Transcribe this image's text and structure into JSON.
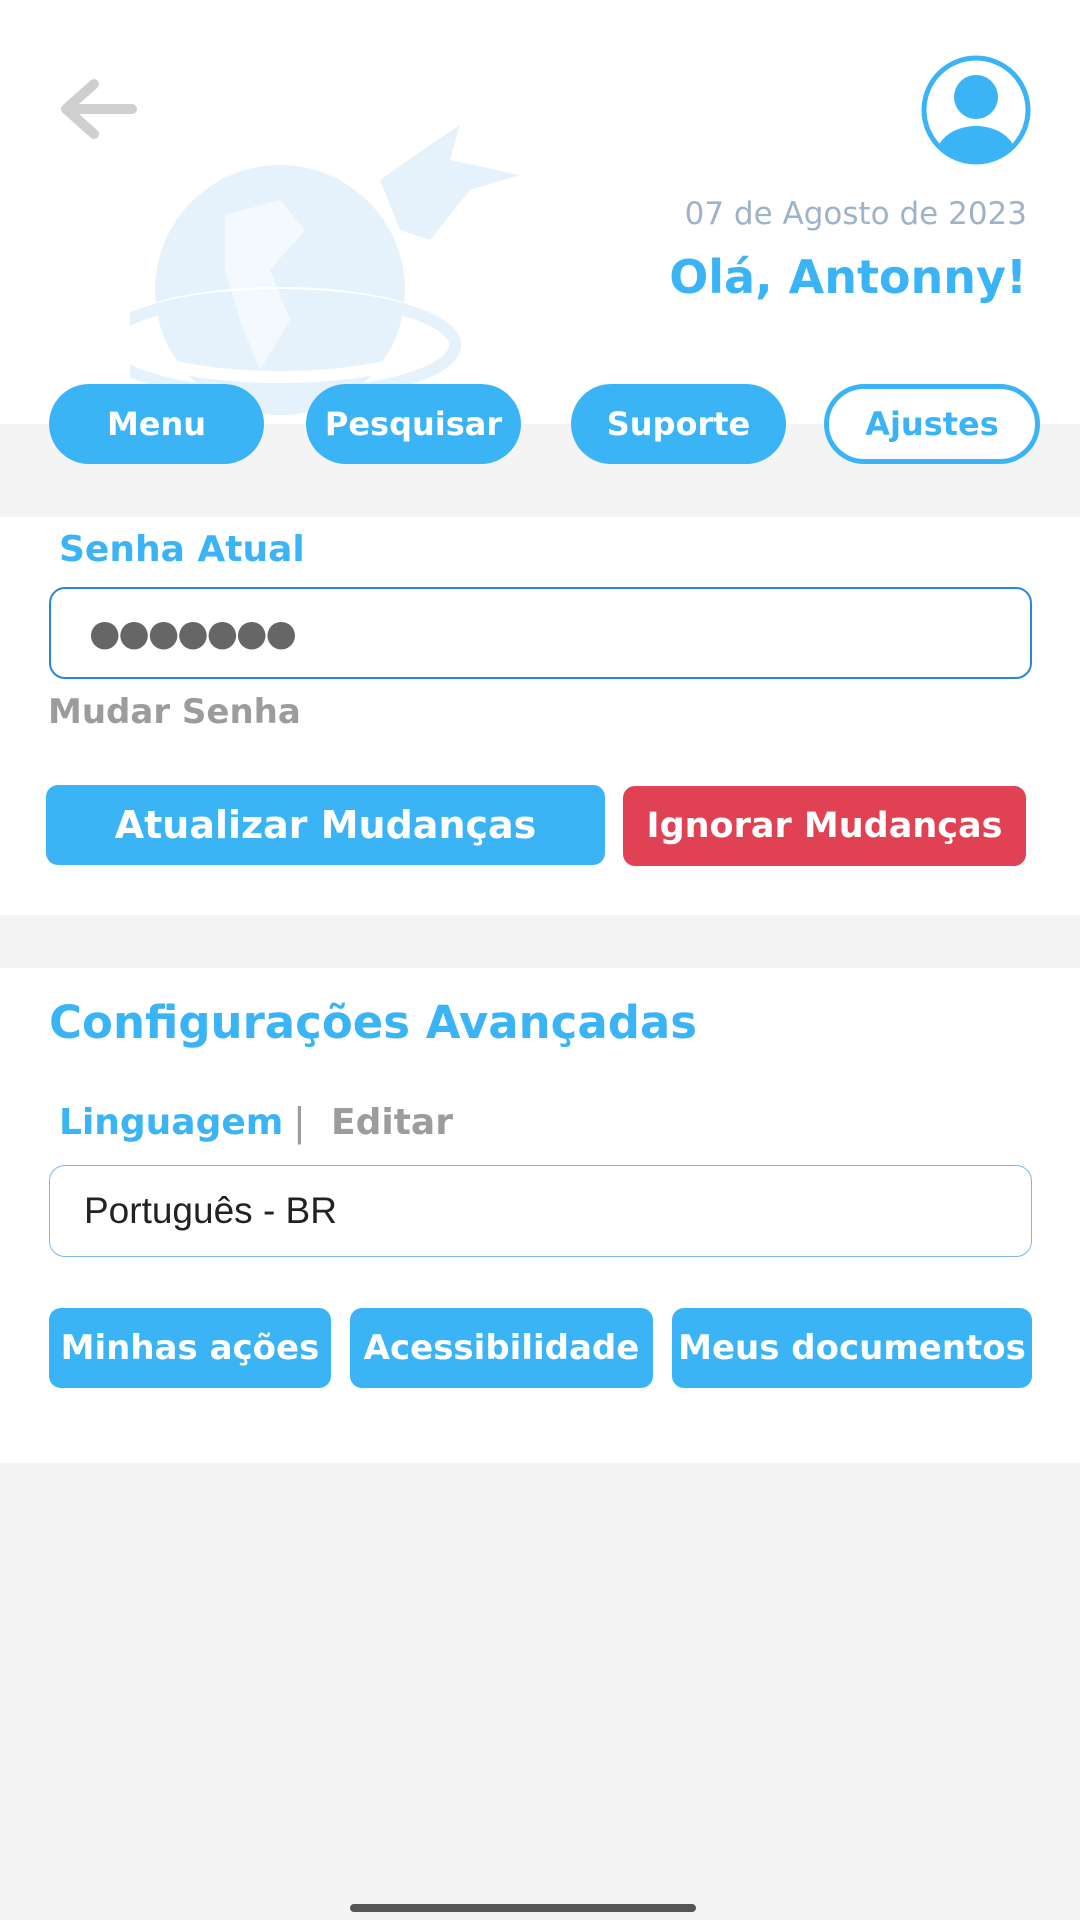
{
  "header": {
    "date": "07 de Agosto de 2023",
    "greeting": "Olá, Antonny!"
  },
  "nav": {
    "tabs": [
      {
        "label": "Menu"
      },
      {
        "label": "Pesquisar"
      },
      {
        "label": "Suporte"
      },
      {
        "label": "Ajustes",
        "active": true
      }
    ]
  },
  "password": {
    "label": "Senha Atual",
    "value": "●●●●●●●",
    "change_link": "Mudar Senha",
    "update_button": "Atualizar Mudanças",
    "ignore_button": "Ignorar Mudanças"
  },
  "advanced": {
    "title": "Configurações Avançadas",
    "language_label": "Linguagem",
    "separator": "|",
    "edit_link": "Editar",
    "language_value": "Português - BR",
    "actions": [
      {
        "label": "Minhas ações"
      },
      {
        "label": "Acessibilidade"
      },
      {
        "label": "Meus documentos"
      }
    ]
  },
  "colors": {
    "accent": "#3bb4f6",
    "danger": "#e14253",
    "background": "#f4f4f4",
    "muted": "#9c9c9c"
  },
  "icons": [
    "back-arrow-icon",
    "user-avatar-icon",
    "globe-hummingbird-logo"
  ]
}
